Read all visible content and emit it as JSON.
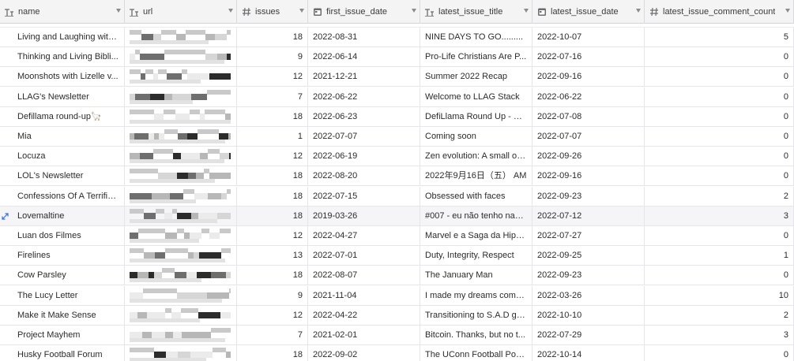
{
  "columns": [
    {
      "key": "name",
      "label": "name",
      "icon": "text-type-icon",
      "width": 158
    },
    {
      "key": "url",
      "label": "url",
      "icon": "text-type-icon",
      "width": 142
    },
    {
      "key": "issues",
      "label": "issues",
      "icon": "hash-type-icon",
      "width": 90
    },
    {
      "key": "first_issue_date",
      "label": "first_issue_date",
      "icon": "calendar-type-icon",
      "width": 142
    },
    {
      "key": "latest_issue_title",
      "label": "latest_issue_title",
      "icon": "text-type-icon",
      "width": 142
    },
    {
      "key": "latest_issue_date",
      "label": "latest_issue_date",
      "icon": "calendar-type-icon",
      "width": 142
    },
    {
      "key": "latest_issue_comment_count",
      "label": "latest_issue_comment_count",
      "icon": "hash-type-icon",
      "width": 189
    }
  ],
  "rows": [
    {
      "name": "Living and Laughing with...",
      "issues": "18",
      "first_issue_date": "2022-08-31",
      "latest_issue_title": "NINE DAYS TO GO.........",
      "latest_issue_date": "2022-10-07",
      "latest_issue_comment_count": "5"
    },
    {
      "name": "Thinking and Living Bibli...",
      "issues": "9",
      "first_issue_date": "2022-06-14",
      "latest_issue_title": "Pro-Life Christians Are P...",
      "latest_issue_date": "2022-07-16",
      "latest_issue_comment_count": "0"
    },
    {
      "name": "Moonshots with Lizelle v...",
      "issues": "12",
      "first_issue_date": "2021-12-21",
      "latest_issue_title": "Summer 2022 Recap",
      "latest_issue_date": "2022-09-16",
      "latest_issue_comment_count": "0"
    },
    {
      "name": "LLAG's Newsletter",
      "issues": "7",
      "first_issue_date": "2022-06-22",
      "latest_issue_title": "Welcome to LLAG Stack",
      "latest_issue_date": "2022-06-22",
      "latest_issue_comment_count": "0"
    },
    {
      "name": "Defillama round-up🦙",
      "issues": "18",
      "first_issue_date": "2022-06-23",
      "latest_issue_title": "DefiLlama Round Up - Fr...",
      "latest_issue_date": "2022-07-08",
      "latest_issue_comment_count": "0"
    },
    {
      "name": "Mia",
      "issues": "1",
      "first_issue_date": "2022-07-07",
      "latest_issue_title": "Coming soon",
      "latest_issue_date": "2022-07-07",
      "latest_issue_comment_count": "0"
    },
    {
      "name": "Locuza",
      "issues": "12",
      "first_issue_date": "2022-06-19",
      "latest_issue_title": "Zen evolution: A small ov...",
      "latest_issue_date": "2022-09-26",
      "latest_issue_comment_count": "0"
    },
    {
      "name": "LOL's Newsletter",
      "issues": "18",
      "first_issue_date": "2022-08-20",
      "latest_issue_title": "2022年9月16日（五） AM",
      "latest_issue_date": "2022-09-16",
      "latest_issue_comment_count": "0"
    },
    {
      "name": "Confessions Of A Terrifie...",
      "issues": "18",
      "first_issue_date": "2022-07-15",
      "latest_issue_title": "Obsessed with faces",
      "latest_issue_date": "2022-09-23",
      "latest_issue_comment_count": "2"
    },
    {
      "name": "Lovemaltine",
      "issues": "18",
      "first_issue_date": "2019-03-26",
      "latest_issue_title": "#007 - eu não tenho nad...",
      "latest_issue_date": "2022-07-12",
      "latest_issue_comment_count": "3"
    },
    {
      "name": "Luan dos Filmes",
      "issues": "12",
      "first_issue_date": "2022-04-27",
      "latest_issue_title": "Marvel e a Saga da Hipér...",
      "latest_issue_date": "2022-07-27",
      "latest_issue_comment_count": "0"
    },
    {
      "name": "Firelines",
      "issues": "13",
      "first_issue_date": "2022-07-01",
      "latest_issue_title": "Duty, Integrity, Respect",
      "latest_issue_date": "2022-09-25",
      "latest_issue_comment_count": "1"
    },
    {
      "name": "Cow Parsley",
      "issues": "18",
      "first_issue_date": "2022-08-07",
      "latest_issue_title": "The January Man",
      "latest_issue_date": "2022-09-23",
      "latest_issue_comment_count": "0"
    },
    {
      "name": "The Lucy Letter",
      "issues": "9",
      "first_issue_date": "2021-11-04",
      "latest_issue_title": "I made my dreams come ...",
      "latest_issue_date": "2022-03-26",
      "latest_issue_comment_count": "10"
    },
    {
      "name": "Make it Make Sense",
      "issues": "12",
      "first_issue_date": "2022-04-22",
      "latest_issue_title": "Transitioning to S.A.D gir...",
      "latest_issue_date": "2022-10-10",
      "latest_issue_comment_count": "2"
    },
    {
      "name": "Project Mayhem",
      "issues": "7",
      "first_issue_date": "2021-02-01",
      "latest_issue_title": "Bitcoin. Thanks, but no t...",
      "latest_issue_date": "2022-07-29",
      "latest_issue_comment_count": "3"
    },
    {
      "name": "Husky Football Forum",
      "issues": "18",
      "first_issue_date": "2022-09-02",
      "latest_issue_title": "The UConn Football Pod:...",
      "latest_issue_date": "2022-10-14",
      "latest_issue_comment_count": "0"
    }
  ],
  "highlight_row": 9,
  "colors": {
    "header_bg": "#f4f4f5",
    "row_border": "#e6e6ea",
    "edit_icon": "#3b6fd6",
    "icon": "#6b6b70"
  }
}
